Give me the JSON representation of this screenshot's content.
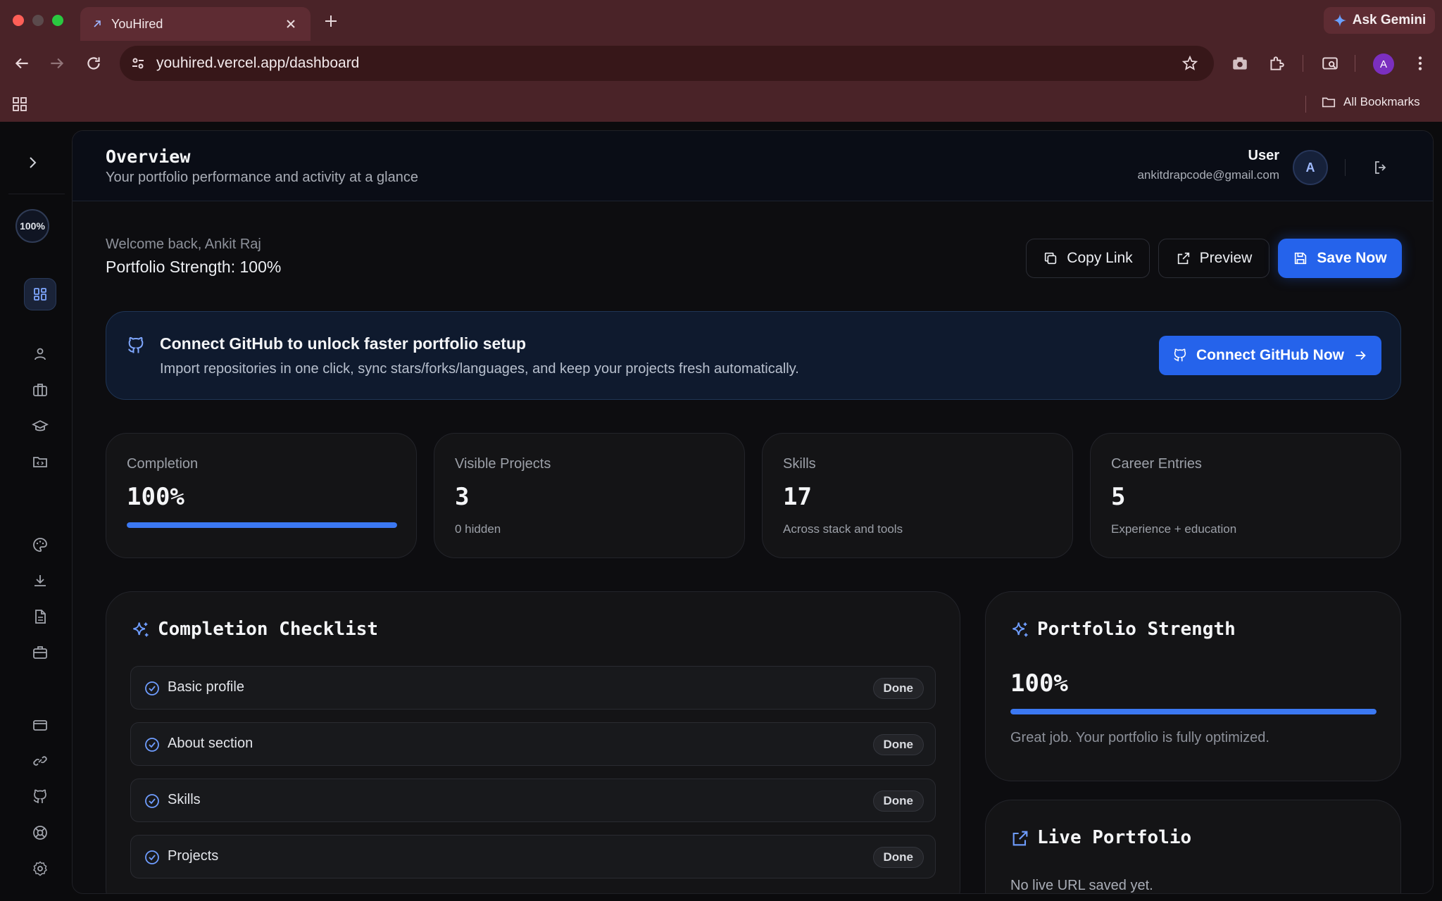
{
  "browser": {
    "tab_title": "YouHired",
    "ask_label": "Ask Gemini",
    "url": "youhired.vercel.app/dashboard",
    "profile_initial": "A",
    "bookmarks_label": "All Bookmarks"
  },
  "sidebar": {
    "progress_label": "100%",
    "items": [
      {
        "icon": "dashboard-icon"
      },
      {
        "icon": "user-icon"
      },
      {
        "icon": "briefcase-icon"
      },
      {
        "icon": "graduation-cap-icon"
      },
      {
        "icon": "folder-code-icon"
      },
      {
        "icon": "palette-icon"
      },
      {
        "icon": "download-icon"
      },
      {
        "icon": "file-text-icon"
      },
      {
        "icon": "briefcase-alt-icon"
      },
      {
        "icon": "credit-card-icon"
      },
      {
        "icon": "link-icon"
      },
      {
        "icon": "github-icon"
      },
      {
        "icon": "lifebuoy-icon"
      },
      {
        "icon": "settings-icon"
      }
    ]
  },
  "header": {
    "title": "Overview",
    "subtitle": "Your portfolio performance and activity at a glance",
    "user_name": "User",
    "user_email": "ankitdrapcode@gmail.com",
    "avatar_initial": "A"
  },
  "welcome": {
    "greeting": "Welcome back, Ankit Raj",
    "strength": "Portfolio Strength: 100%"
  },
  "actions": {
    "copy_link": "Copy Link",
    "preview": "Preview",
    "save_now": "Save Now"
  },
  "github_banner": {
    "title": "Connect GitHub to unlock faster portfolio setup",
    "description": "Import repositories in one click, sync stars/forks/languages, and keep your projects fresh automatically.",
    "button": "Connect GitHub Now"
  },
  "stats": [
    {
      "label": "Completion",
      "value": "100%",
      "progress": 1.0
    },
    {
      "label": "Visible Projects",
      "value": "3",
      "sub": "0 hidden"
    },
    {
      "label": "Skills",
      "value": "17",
      "sub": "Across stack and tools"
    },
    {
      "label": "Career Entries",
      "value": "5",
      "sub": "Experience + education"
    }
  ],
  "checklist": {
    "title": "Completion Checklist",
    "items": [
      {
        "label": "Basic profile",
        "status": "Done"
      },
      {
        "label": "About section",
        "status": "Done"
      },
      {
        "label": "Skills",
        "status": "Done"
      },
      {
        "label": "Projects",
        "status": "Done"
      }
    ]
  },
  "portfolio_strength": {
    "title": "Portfolio Strength",
    "value": "100%",
    "progress": 1.0,
    "message": "Great job. Your portfolio is fully optimized."
  },
  "live_portfolio": {
    "title": "Live Portfolio",
    "message": "No live URL saved yet."
  },
  "colors": {
    "accent": "#2563eb",
    "chrome": "#4a2328",
    "background": "#0b0b0d"
  }
}
